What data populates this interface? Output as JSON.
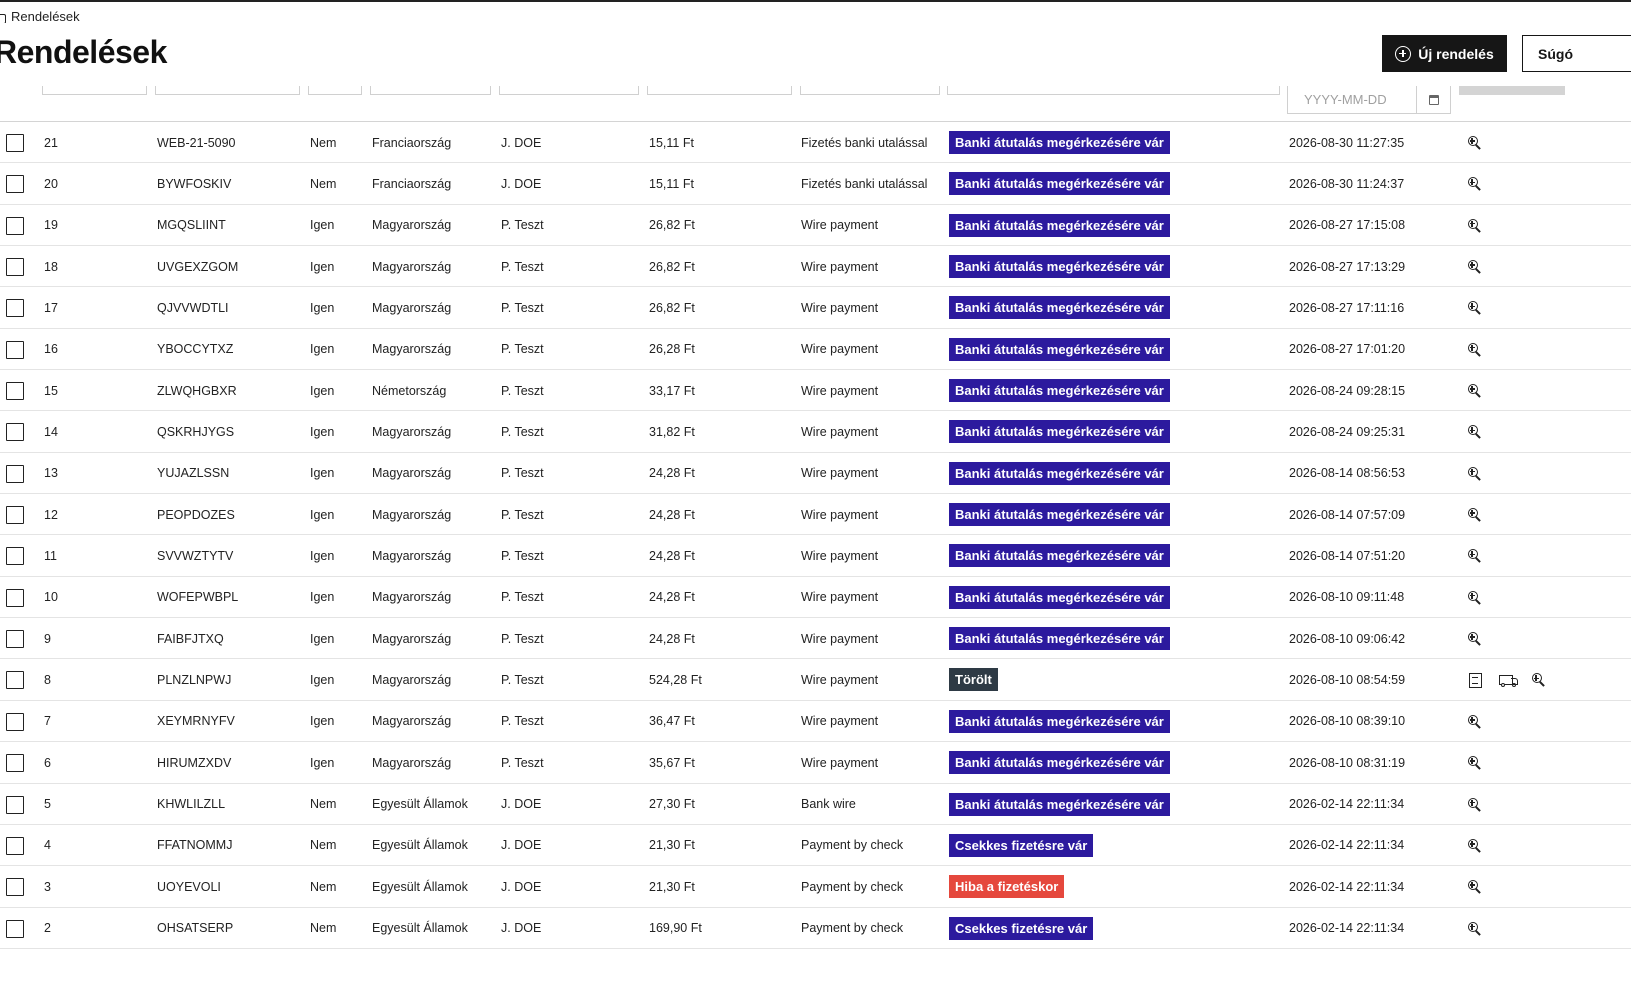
{
  "breadcrumb": {
    "label": "Rendelések"
  },
  "page": {
    "title": "Rendelések"
  },
  "header": {
    "new_order_label": "Új rendelés",
    "help_label": "Súgó"
  },
  "filters": {
    "date_placeholder": "YYYY-MM-DD"
  },
  "colors": {
    "awaiting_badge": "#2c1a9e",
    "error_badge": "#e5483d",
    "deleted_badge": "#2e3a45",
    "primary_button": "#161616"
  },
  "orders": [
    {
      "id": "21",
      "reference": "WEB-21-5090",
      "new_customer": "Nem",
      "country": "Franciaország",
      "customer": "J. DOE",
      "total": "15,11 Ft",
      "payment": "Fizetés banki utalással",
      "status": "Banki átutalás megérkezésére vár",
      "status_type": "bank",
      "date": "2026-08-30 11:27:35",
      "actions": [
        "zoom"
      ]
    },
    {
      "id": "20",
      "reference": "BYWFOSKIV",
      "new_customer": "Nem",
      "country": "Franciaország",
      "customer": "J. DOE",
      "total": "15,11 Ft",
      "payment": "Fizetés banki utalással",
      "status": "Banki átutalás megérkezésére vár",
      "status_type": "bank",
      "date": "2026-08-30 11:24:37",
      "actions": [
        "zoom"
      ]
    },
    {
      "id": "19",
      "reference": "MGQSLIINT",
      "new_customer": "Igen",
      "country": "Magyarország",
      "customer": "P. Teszt",
      "total": "26,82 Ft",
      "payment": "Wire payment",
      "status": "Banki átutalás megérkezésére vár",
      "status_type": "bank",
      "date": "2026-08-27 17:15:08",
      "actions": [
        "zoom"
      ]
    },
    {
      "id": "18",
      "reference": "UVGEXZGOM",
      "new_customer": "Igen",
      "country": "Magyarország",
      "customer": "P. Teszt",
      "total": "26,82 Ft",
      "payment": "Wire payment",
      "status": "Banki átutalás megérkezésére vár",
      "status_type": "bank",
      "date": "2026-08-27 17:13:29",
      "actions": [
        "zoom"
      ]
    },
    {
      "id": "17",
      "reference": "QJVVWDTLI",
      "new_customer": "Igen",
      "country": "Magyarország",
      "customer": "P. Teszt",
      "total": "26,82 Ft",
      "payment": "Wire payment",
      "status": "Banki átutalás megérkezésére vár",
      "status_type": "bank",
      "date": "2026-08-27 17:11:16",
      "actions": [
        "zoom"
      ]
    },
    {
      "id": "16",
      "reference": "YBOCCYTXZ",
      "new_customer": "Igen",
      "country": "Magyarország",
      "customer": "P. Teszt",
      "total": "26,28 Ft",
      "payment": "Wire payment",
      "status": "Banki átutalás megérkezésére vár",
      "status_type": "bank",
      "date": "2026-08-27 17:01:20",
      "actions": [
        "zoom"
      ]
    },
    {
      "id": "15",
      "reference": "ZLWQHGBXR",
      "new_customer": "Igen",
      "country": "Németország",
      "customer": "P. Teszt",
      "total": "33,17 Ft",
      "payment": "Wire payment",
      "status": "Banki átutalás megérkezésére vár",
      "status_type": "bank",
      "date": "2026-08-24 09:28:15",
      "actions": [
        "zoom"
      ]
    },
    {
      "id": "14",
      "reference": "QSKRHJYGS",
      "new_customer": "Igen",
      "country": "Magyarország",
      "customer": "P. Teszt",
      "total": "31,82 Ft",
      "payment": "Wire payment",
      "status": "Banki átutalás megérkezésére vár",
      "status_type": "bank",
      "date": "2026-08-24 09:25:31",
      "actions": [
        "zoom"
      ]
    },
    {
      "id": "13",
      "reference": "YUJAZLSSN",
      "new_customer": "Igen",
      "country": "Magyarország",
      "customer": "P. Teszt",
      "total": "24,28 Ft",
      "payment": "Wire payment",
      "status": "Banki átutalás megérkezésére vár",
      "status_type": "bank",
      "date": "2026-08-14 08:56:53",
      "actions": [
        "zoom"
      ]
    },
    {
      "id": "12",
      "reference": "PEOPDOZES",
      "new_customer": "Igen",
      "country": "Magyarország",
      "customer": "P. Teszt",
      "total": "24,28 Ft",
      "payment": "Wire payment",
      "status": "Banki átutalás megérkezésére vár",
      "status_type": "bank",
      "date": "2026-08-14 07:57:09",
      "actions": [
        "zoom"
      ]
    },
    {
      "id": "11",
      "reference": "SVVWZTYTV",
      "new_customer": "Igen",
      "country": "Magyarország",
      "customer": "P. Teszt",
      "total": "24,28 Ft",
      "payment": "Wire payment",
      "status": "Banki átutalás megérkezésére vár",
      "status_type": "bank",
      "date": "2026-08-14 07:51:20",
      "actions": [
        "zoom"
      ]
    },
    {
      "id": "10",
      "reference": "WOFEPWBPL",
      "new_customer": "Igen",
      "country": "Magyarország",
      "customer": "P. Teszt",
      "total": "24,28 Ft",
      "payment": "Wire payment",
      "status": "Banki átutalás megérkezésére vár",
      "status_type": "bank",
      "date": "2026-08-10 09:11:48",
      "actions": [
        "zoom"
      ]
    },
    {
      "id": "9",
      "reference": "FAIBFJTXQ",
      "new_customer": "Igen",
      "country": "Magyarország",
      "customer": "P. Teszt",
      "total": "24,28 Ft",
      "payment": "Wire payment",
      "status": "Banki átutalás megérkezésére vár",
      "status_type": "bank",
      "date": "2026-08-10 09:06:42",
      "actions": [
        "zoom"
      ]
    },
    {
      "id": "8",
      "reference": "PLNZLNPWJ",
      "new_customer": "Igen",
      "country": "Magyarország",
      "customer": "P. Teszt",
      "total": "524,28 Ft",
      "payment": "Wire payment",
      "status": "Törölt",
      "status_type": "deleted",
      "date": "2026-08-10 08:54:59",
      "actions": [
        "invoice",
        "delivery",
        "zoom"
      ]
    },
    {
      "id": "7",
      "reference": "XEYMRNYFV",
      "new_customer": "Igen",
      "country": "Magyarország",
      "customer": "P. Teszt",
      "total": "36,47 Ft",
      "payment": "Wire payment",
      "status": "Banki átutalás megérkezésére vár",
      "status_type": "bank",
      "date": "2026-08-10 08:39:10",
      "actions": [
        "zoom"
      ]
    },
    {
      "id": "6",
      "reference": "HIRUMZXDV",
      "new_customer": "Igen",
      "country": "Magyarország",
      "customer": "P. Teszt",
      "total": "35,67 Ft",
      "payment": "Wire payment",
      "status": "Banki átutalás megérkezésére vár",
      "status_type": "bank",
      "date": "2026-08-10 08:31:19",
      "actions": [
        "zoom"
      ]
    },
    {
      "id": "5",
      "reference": "KHWLILZLL",
      "new_customer": "Nem",
      "country": "Egyesült Államok",
      "customer": "J. DOE",
      "total": "27,30 Ft",
      "payment": "Bank wire",
      "status": "Banki átutalás megérkezésére vár",
      "status_type": "bank",
      "date": "2026-02-14 22:11:34",
      "actions": [
        "zoom"
      ]
    },
    {
      "id": "4",
      "reference": "FFATNOMMJ",
      "new_customer": "Nem",
      "country": "Egyesült Államok",
      "customer": "J. DOE",
      "total": "21,30 Ft",
      "payment": "Payment by check",
      "status": "Csekkes fizetésre vár",
      "status_type": "check",
      "date": "2026-02-14 22:11:34",
      "actions": [
        "zoom"
      ]
    },
    {
      "id": "3",
      "reference": "UOYEVOLI",
      "new_customer": "Nem",
      "country": "Egyesült Államok",
      "customer": "J. DOE",
      "total": "21,30 Ft",
      "payment": "Payment by check",
      "status": "Hiba a fizetéskor",
      "status_type": "error",
      "date": "2026-02-14 22:11:34",
      "actions": [
        "zoom"
      ]
    },
    {
      "id": "2",
      "reference": "OHSATSERP",
      "new_customer": "Nem",
      "country": "Egyesült Államok",
      "customer": "J. DOE",
      "total": "169,90 Ft",
      "payment": "Payment by check",
      "status": "Csekkes fizetésre vár",
      "status_type": "check",
      "date": "2026-02-14 22:11:34",
      "actions": [
        "zoom"
      ]
    }
  ]
}
